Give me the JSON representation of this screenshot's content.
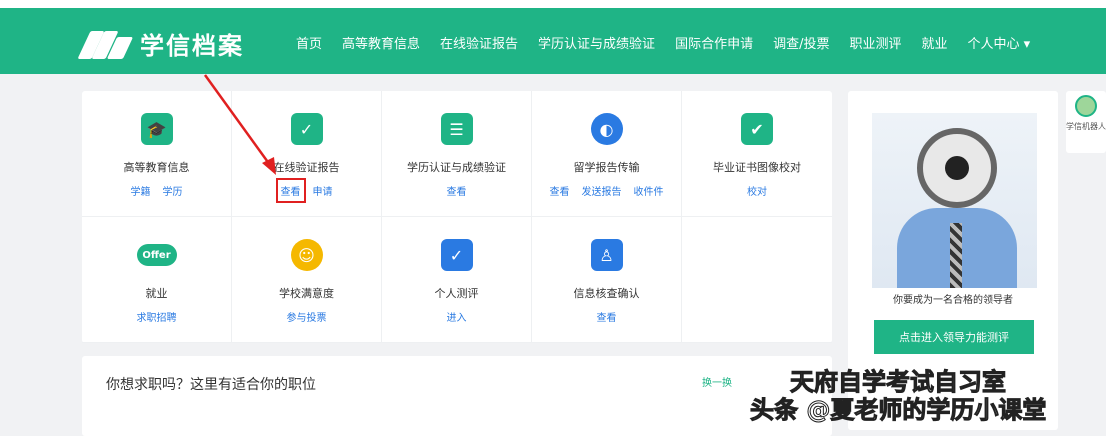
{
  "header": {
    "logo_text": "学信档案",
    "menu": [
      "首页",
      "高等教育信息",
      "在线验证报告",
      "学历认证与成绩验证",
      "国际合作申请",
      "调查/投票",
      "职业测评",
      "就业",
      "个人中心 ▾"
    ]
  },
  "services": [
    {
      "label": "高等教育信息",
      "links": [
        "学籍",
        "学历"
      ],
      "color": "#1fb486",
      "icon": "graduate-icon",
      "glyph": "🎓"
    },
    {
      "label": "在线验证报告",
      "links": [
        "查看",
        "申请"
      ],
      "color": "#1fb486",
      "icon": "shield-check-icon",
      "glyph": "✓"
    },
    {
      "label": "学历认证与成绩验证",
      "links": [
        "查看"
      ],
      "color": "#1fb486",
      "icon": "certificate-icon",
      "glyph": "☰"
    },
    {
      "label": "留学报告传输",
      "links": [
        "查看",
        "发送报告",
        "收件件"
      ],
      "color": "#2a7ae2",
      "icon": "globe-icon",
      "glyph": "◐"
    },
    {
      "label": "毕业证书图像校对",
      "links": [
        "校对"
      ],
      "color": "#1fb486",
      "icon": "user-check-icon",
      "glyph": "✔"
    },
    {
      "label": "就业",
      "links": [
        "求职招聘"
      ],
      "color": "#1fb486",
      "icon": "offer-icon",
      "glyph": "Offer"
    },
    {
      "label": "学校满意度",
      "links": [
        "参与投票"
      ],
      "color": "#f5b800",
      "icon": "smile-icon",
      "glyph": "☺"
    },
    {
      "label": "个人测评",
      "links": [
        "进入"
      ],
      "color": "#2a7ae2",
      "icon": "clipboard-check-icon",
      "glyph": "✓"
    },
    {
      "label": "信息核查确认",
      "links": [
        "查看"
      ],
      "color": "#2a7ae2",
      "icon": "shield-user-icon",
      "glyph": "♙"
    }
  ],
  "side": {
    "text": "你要成为一名合格的领导者",
    "button": "点击进入领导力能测评"
  },
  "robot": "学信机器人",
  "jobs": {
    "title": "你想求职吗？这里有适合你的职位",
    "more": "换一换"
  },
  "watermark": {
    "line1": "天府自学考试自习室",
    "line2": "头条 @夏老师的学历小课堂"
  }
}
